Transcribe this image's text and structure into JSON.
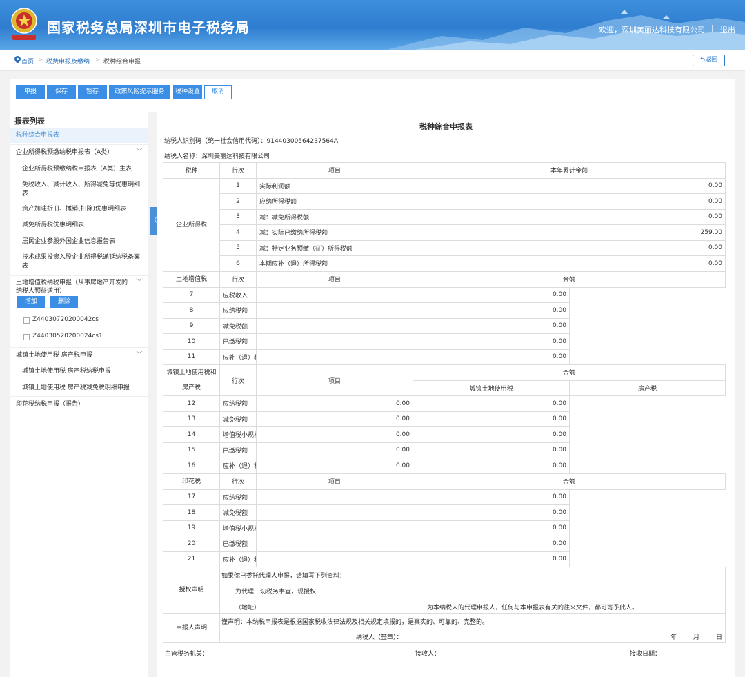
{
  "header": {
    "site_title": "国家税务总局深圳市电子税务局",
    "welcome": "欢迎，深圳美丽达科技有限公司",
    "separator": "|",
    "logout": "退出",
    "emblem_icon": "tax-emblem-icon"
  },
  "breadcrumb": {
    "home": "首页",
    "level2": "税费申报及缴纳",
    "current": "税种综合申报",
    "back": "返回"
  },
  "toolbar": {
    "declare": "申报",
    "save": "保存",
    "temp_save": "暂存",
    "policy_risk": "政策风险提示服务",
    "tax_settings": "税种设置",
    "cancel": "取消"
  },
  "sidebar": {
    "title": "报表列表",
    "active": "税种综合申报表",
    "group1": "企业所得税预缴纳税申报表（A类）",
    "group1_items": [
      "企业所得税预缴纳税申报表（A类）主表",
      "免税收入、减计收入、所得减免等优惠明细表",
      "资产加速折旧、摊销(扣除)优惠明细表",
      "减免所得税优惠明细表",
      "居民企业参股外国企业信息报告表",
      "技术成果投资入股企业所得税递延纳税备案表"
    ],
    "group2": "土地增值税纳税申报（从事房地产开发的纳税人预征适用）",
    "add": "增加",
    "delete": "删除",
    "group2_items": [
      "Z44030720200042cs",
      "Z44030520200024cs1"
    ],
    "group3": "城镇土地使用税 房产税申报",
    "group3_items": [
      "城镇土地使用税 房产税纳税申报",
      "城镇土地使用税 房产税减免税明细申报"
    ],
    "group4": "印花税纳税申报（报告）",
    "collapse": "〈"
  },
  "form": {
    "title": "税种综合申报表",
    "taxpayer_id": "纳税人识别码（统一社会信用代码）：91440300564237564A",
    "taxpayer_name": "纳税人名称：深圳美丽达科技有限公司",
    "col_tax": "税种",
    "col_row": "行次",
    "col_item": "项目",
    "col_ytd": "本年累计金额",
    "col_amount": "金额",
    "col_land": "城镇土地使用税",
    "col_property": "房产税",
    "cit": {
      "name": "企业所得税",
      "rows": [
        {
          "no": "1",
          "item": "实际利润额",
          "amount": "0.00"
        },
        {
          "no": "2",
          "item": "应纳所得税额",
          "amount": "0.00"
        },
        {
          "no": "3",
          "item": "减：减免所得税额",
          "amount": "0.00"
        },
        {
          "no": "4",
          "item": "减：实际已缴纳所得税额",
          "amount": "259.00"
        },
        {
          "no": "5",
          "item": "减：特定业务预缴（征）所得税额",
          "amount": "0.00"
        },
        {
          "no": "6",
          "item": "本期应补（退）所得税额",
          "amount": "0.00"
        }
      ]
    },
    "lvat": {
      "name": "土地增值税",
      "rows": [
        {
          "no": "7",
          "item": "应税收入",
          "amount": "0.00"
        },
        {
          "no": "8",
          "item": "应纳税额",
          "amount": "0.00"
        },
        {
          "no": "9",
          "item": "减免税额",
          "amount": "0.00"
        },
        {
          "no": "10",
          "item": "已缴税额",
          "amount": "0.00"
        },
        {
          "no": "11",
          "item": "应补（退）税额",
          "amount": "0.00"
        }
      ]
    },
    "land": {
      "name": "城镇土地使用税和房产税",
      "rows": [
        {
          "no": "12",
          "item": "应纳税额",
          "land": "0.00",
          "property": "0.00"
        },
        {
          "no": "13",
          "item": "减免税额",
          "land": "0.00",
          "property": "0.00"
        },
        {
          "no": "14",
          "item": "增值税小规模纳税人减征额",
          "land": "0.00",
          "property": "0.00"
        },
        {
          "no": "15",
          "item": "已缴税额",
          "land": "0.00",
          "property": "0.00"
        },
        {
          "no": "16",
          "item": "应补（退）税额",
          "land": "0.00",
          "property": "0.00"
        }
      ]
    },
    "stamp": {
      "name": "印花税",
      "rows": [
        {
          "no": "17",
          "item": "应纳税额",
          "amount": "0.00"
        },
        {
          "no": "18",
          "item": "减免税额",
          "amount": "0.00"
        },
        {
          "no": "19",
          "item": "增值税小规模纳税人减征额",
          "amount": "0.00"
        },
        {
          "no": "20",
          "item": "已缴税额",
          "amount": "0.00"
        },
        {
          "no": "21",
          "item": "应补（退）税额",
          "amount": "0.00"
        }
      ]
    },
    "auth": {
      "name": "授权声明",
      "line1": "如果你已委托代理人申报，请填写下列资料：",
      "line2": "为代理一切税务事宜，现授权",
      "line3a": "（地址）",
      "line3b": "为本纳税人的代理申报人，任何与本申报表有关的往来文件，都可寄予此人。"
    },
    "declarant": {
      "name": "申报人声明",
      "line1": "谨声明：本纳税申报表是根据国家税收法律法规及相关规定填报的，是真实的、可靠的、完整的。",
      "sign": "纳税人（签章）：",
      "year": "年",
      "month": "月",
      "day": "日"
    },
    "footer": {
      "office": "主管税务机关：",
      "receiver": "接收人：",
      "date": "接收日期："
    }
  }
}
